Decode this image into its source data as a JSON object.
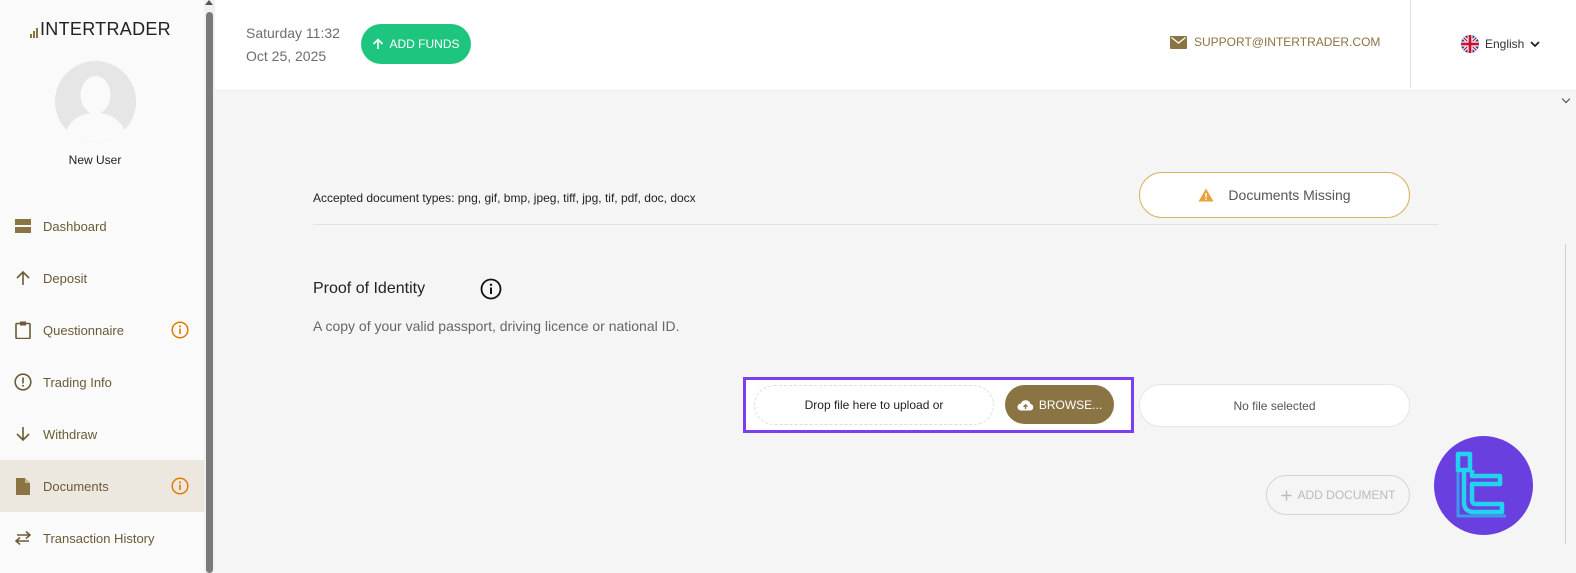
{
  "brand": {
    "logo_text": "INTERTRADER",
    "accent": "#8a7444",
    "add_funds_color": "#1ec57e",
    "highlight_color": "#7b3ff0"
  },
  "user": {
    "name": "New User"
  },
  "sidebar": {
    "items": [
      {
        "label": "Dashboard",
        "icon": "dashboard-icon",
        "badge": false,
        "active": false
      },
      {
        "label": "Deposit",
        "icon": "arrow-up-icon",
        "badge": false,
        "active": false
      },
      {
        "label": "Questionnaire",
        "icon": "clipboard-icon",
        "badge": true,
        "active": false
      },
      {
        "label": "Trading Info",
        "icon": "alert-circle-icon",
        "badge": false,
        "active": false
      },
      {
        "label": "Withdraw",
        "icon": "arrow-down-icon",
        "badge": false,
        "active": false
      },
      {
        "label": "Documents",
        "icon": "document-icon",
        "badge": true,
        "active": true
      },
      {
        "label": "Transaction History",
        "icon": "swap-icon",
        "badge": false,
        "active": false
      }
    ]
  },
  "header": {
    "day_time": "Saturday 11:32",
    "date": "Oct 25, 2025",
    "add_funds_label": "ADD FUNDS",
    "support_email": "SUPPORT@INTERTRADER.COM",
    "language": "English"
  },
  "documents": {
    "accepted_types": "Accepted document types: png, gif, bmp, jpeg, tiff, jpg, tif, pdf, doc, docx",
    "status": "Documents Missing",
    "section_title": "Proof of Identity",
    "section_desc": "A copy of your valid passport, driving licence or national ID.",
    "dropzone_text": "Drop file here to upload or",
    "browse_label": "BROWSE...",
    "no_file_text": "No file selected",
    "add_document_label": "ADD DOCUMENT"
  }
}
